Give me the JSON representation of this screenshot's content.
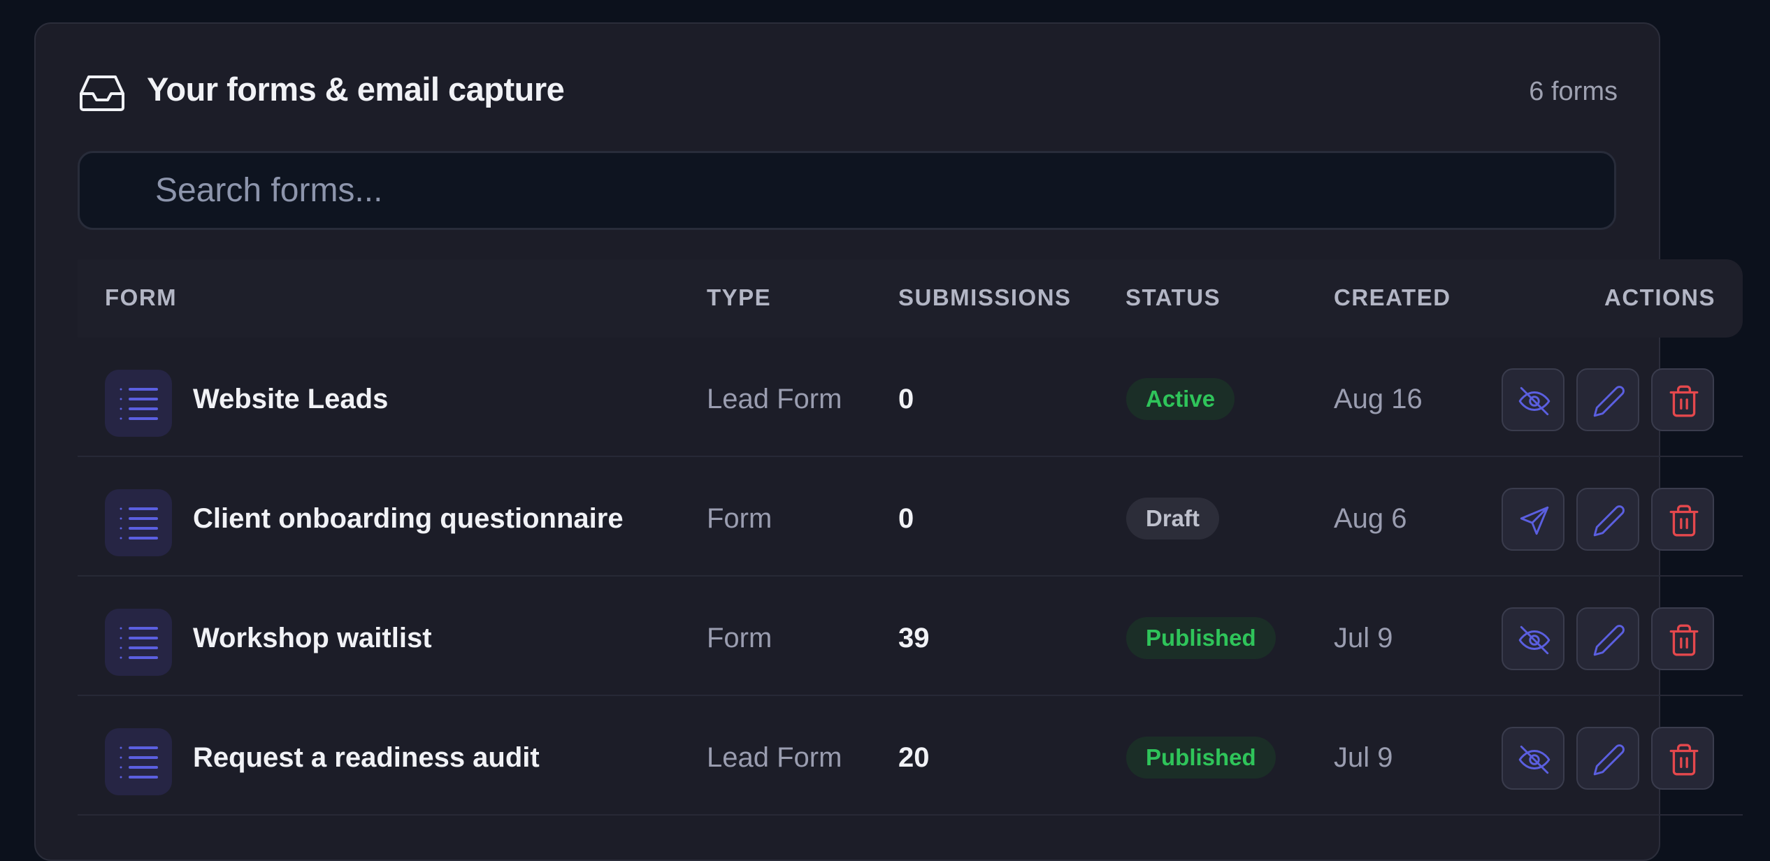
{
  "header": {
    "title": "Your forms & email capture",
    "count": "6 forms"
  },
  "search": {
    "placeholder": "Search forms..."
  },
  "columns": {
    "form": "FORM",
    "type": "TYPE",
    "submissions": "SUBMISSIONS",
    "status": "STATUS",
    "created": "CREATED",
    "actions": "ACTIONS"
  },
  "rows": [
    {
      "name": "Website Leads",
      "type": "Lead Form",
      "submissions": "0",
      "status": "Active",
      "created": "Aug 16",
      "toggle_icon": "eye-off-icon"
    },
    {
      "name": "Client onboarding questionnaire",
      "type": "Form",
      "submissions": "0",
      "status": "Draft",
      "created": "Aug 6",
      "toggle_icon": "send-icon"
    },
    {
      "name": "Workshop waitlist",
      "type": "Form",
      "submissions": "39",
      "status": "Published",
      "created": "Jul 9",
      "toggle_icon": "eye-off-icon"
    },
    {
      "name": "Request a readiness audit",
      "type": "Lead Form",
      "submissions": "20",
      "status": "Published",
      "created": "Jul 9",
      "toggle_icon": "eye-off-icon"
    }
  ],
  "colors": {
    "background": "#0c111c",
    "card": "#1c1d28",
    "accent": "#5b5fe0",
    "danger": "#e5484d",
    "success": "#2fc45a"
  }
}
